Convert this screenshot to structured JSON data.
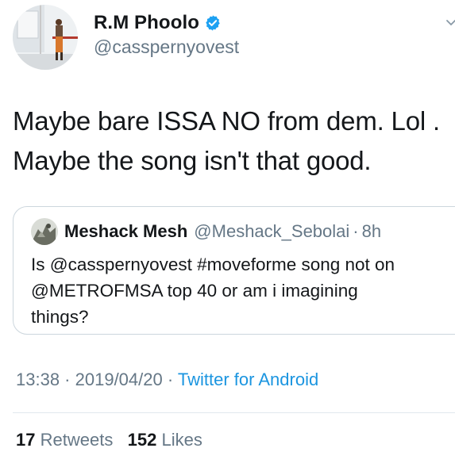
{
  "author": {
    "name": "R.M Phoolo",
    "handle": "@casspernyovest",
    "verified": true
  },
  "tweet": {
    "lines": [
      "Maybe bare ISSA NO from dem. Lol .",
      "Maybe the song isn't that good."
    ]
  },
  "quoted_tweet": {
    "name": "Meshack Mesh",
    "handle": "@Meshack_Sebolai",
    "separator": "·",
    "time": "8h",
    "lines": [
      "Is @casspernyovest #moveforme song not on",
      "@METROFMSA top 40 or am i imagining",
      "things?"
    ]
  },
  "meta": {
    "time": "13:38",
    "sep1": " · ",
    "date": "2019/04/20",
    "sep2": " · ",
    "source": "Twitter for Android"
  },
  "stats": {
    "retweets_count": "17",
    "retweets_label": "Retweets",
    "likes_count": "152",
    "likes_label": "Likes"
  },
  "colors": {
    "text": "#14171a",
    "muted": "#657786",
    "link": "#1b95e0",
    "verified": "#1da1f2",
    "border": "#ccd6dd"
  },
  "icons": {
    "verified": "verified-badge-icon",
    "caret": "chevron-down-icon"
  }
}
